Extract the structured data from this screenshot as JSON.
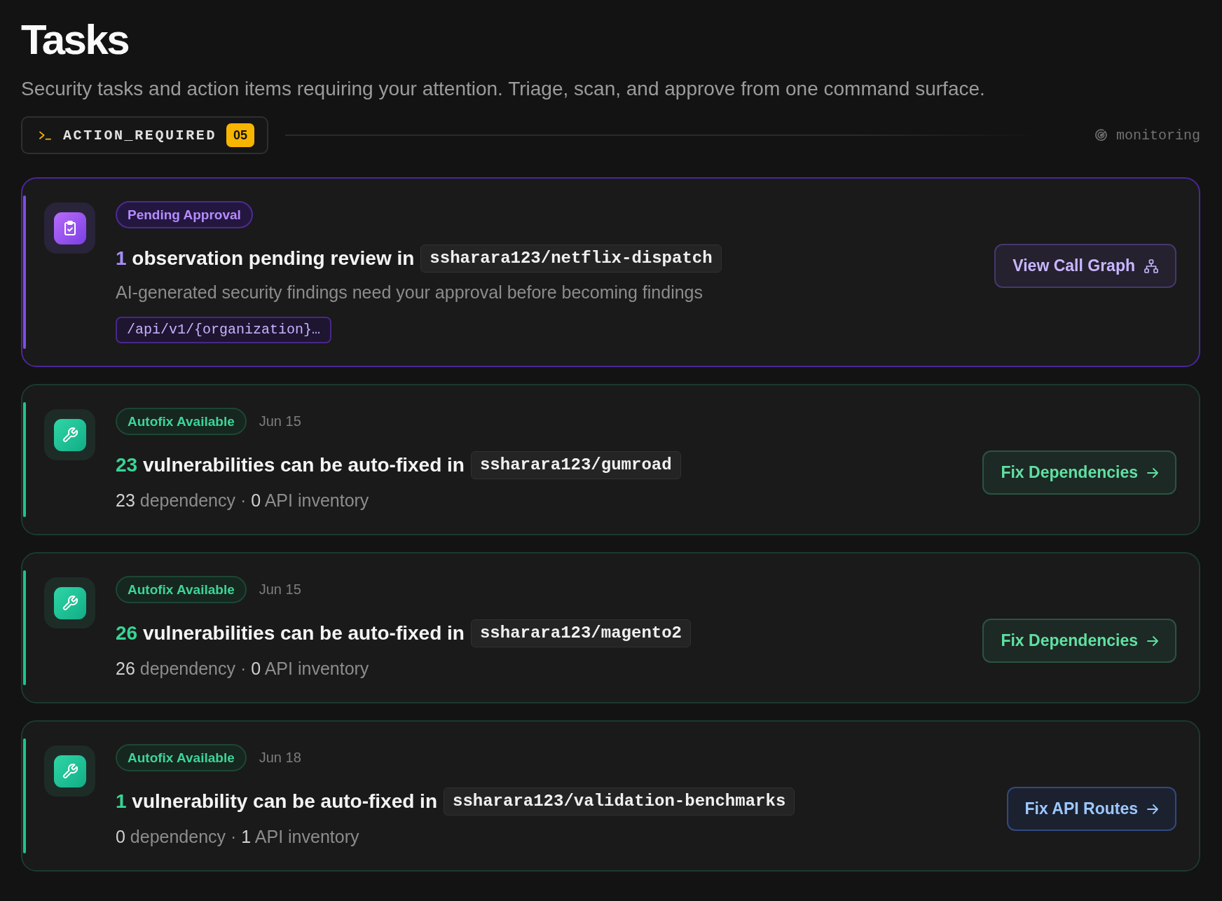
{
  "page": {
    "title": "Tasks",
    "subtitle": "Security tasks and action items requiring your attention. Triage, scan, and approve from one command surface."
  },
  "status": {
    "label": "ACTION_REQUIRED",
    "count": "05",
    "indicator": "monitoring"
  },
  "tasks": [
    {
      "kind": "approval",
      "badge": "Pending Approval",
      "count": "1",
      "headline": "observation pending review in",
      "repo": "ssharara123/netflix-dispatch",
      "description": "AI-generated security findings need your approval before becoming findings",
      "path": "/api/v1/{organization}…",
      "button": {
        "kind": "graph",
        "label": "View Call Graph"
      }
    },
    {
      "kind": "autofix",
      "badge": "Autofix Available",
      "date": "Jun 15",
      "count": "23",
      "headline": "vulnerabilities can be auto-fixed in",
      "repo": "ssharara123/gumroad",
      "meta": "**23** dependency · **0** API inventory",
      "button": {
        "kind": "dependencies",
        "label": "Fix Dependencies"
      }
    },
    {
      "kind": "autofix",
      "badge": "Autofix Available",
      "date": "Jun 15",
      "count": "26",
      "headline": "vulnerabilities can be auto-fixed in",
      "repo": "ssharara123/magento2",
      "meta": "**26** dependency · **0** API inventory",
      "button": {
        "kind": "dependencies",
        "label": "Fix Dependencies"
      }
    },
    {
      "kind": "autofix",
      "badge": "Autofix Available",
      "date": "Jun 18",
      "count": "1",
      "headline": "vulnerability can be auto-fixed in",
      "repo": "ssharara123/validation-benchmarks",
      "meta": "**0** dependency · **1** API inventory",
      "button": {
        "kind": "api_routes",
        "label": "Fix API Routes"
      }
    }
  ]
}
